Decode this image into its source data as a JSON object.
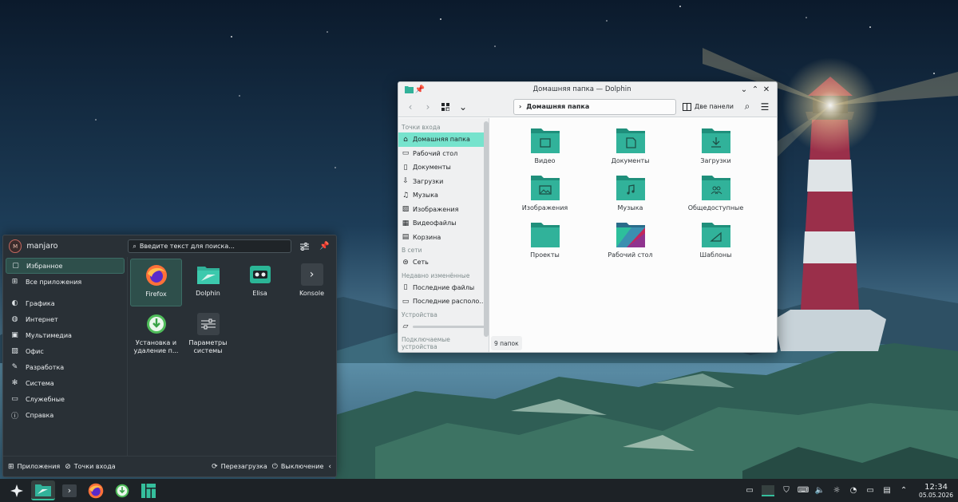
{
  "dolphin": {
    "title": "Домашняя папка — Dolphin",
    "path": "Домашняя папка",
    "split_label": "Две панели",
    "places": {
      "header_places": "Точки входа",
      "items": [
        "Домашняя папка",
        "Рабочий стол",
        "Документы",
        "Загрузки",
        "Музыка",
        "Изображения",
        "Видеофайлы",
        "Корзина"
      ],
      "header_network": "В сети",
      "network": "Сеть",
      "header_recent": "Недавно изменённые",
      "recent": [
        "Последние файлы",
        "Последние располо..."
      ],
      "header_devices": "Устройства",
      "header_removable": "Подключаемые устройства"
    },
    "folders": [
      "Видео",
      "Документы",
      "Загрузки",
      "Изображения",
      "Музыка",
      "Общедоступные",
      "Проекты",
      "Рабочий стол",
      "Шаблоны"
    ],
    "status": "9 папок"
  },
  "launcher": {
    "user": "manjaro",
    "avatar_initial": "M",
    "search_placeholder": "Введите текст для поиска...",
    "categories_top": [
      "Избранное",
      "Все приложения"
    ],
    "categories": [
      "Графика",
      "Интернет",
      "Мультимедиа",
      "Офис",
      "Разработка",
      "Система",
      "Служебные",
      "Справка"
    ],
    "apps": [
      {
        "label": "Firefox",
        "icon": "firefox-icon"
      },
      {
        "label": "Dolphin",
        "icon": "folder-icon"
      },
      {
        "label": "Elisa",
        "icon": "music-player-icon"
      },
      {
        "label": "Konsole",
        "icon": "terminal-icon"
      },
      {
        "label": "Установка и удаление п...",
        "icon": "package-install-icon"
      },
      {
        "label": "Параметры системы",
        "icon": "settings-icon"
      }
    ],
    "footer": {
      "apps": "Приложения",
      "places": "Точки входа",
      "reboot": "Перезагрузка",
      "shutdown": "Выключение"
    }
  },
  "panel": {
    "time": "12:34",
    "date": "05.05.2026"
  },
  "colors": {
    "accent": "#35bf9c",
    "folder": "#31b29a",
    "highlight": "#76e3cd",
    "panel": "#1d2226",
    "launcher": "#293036"
  }
}
